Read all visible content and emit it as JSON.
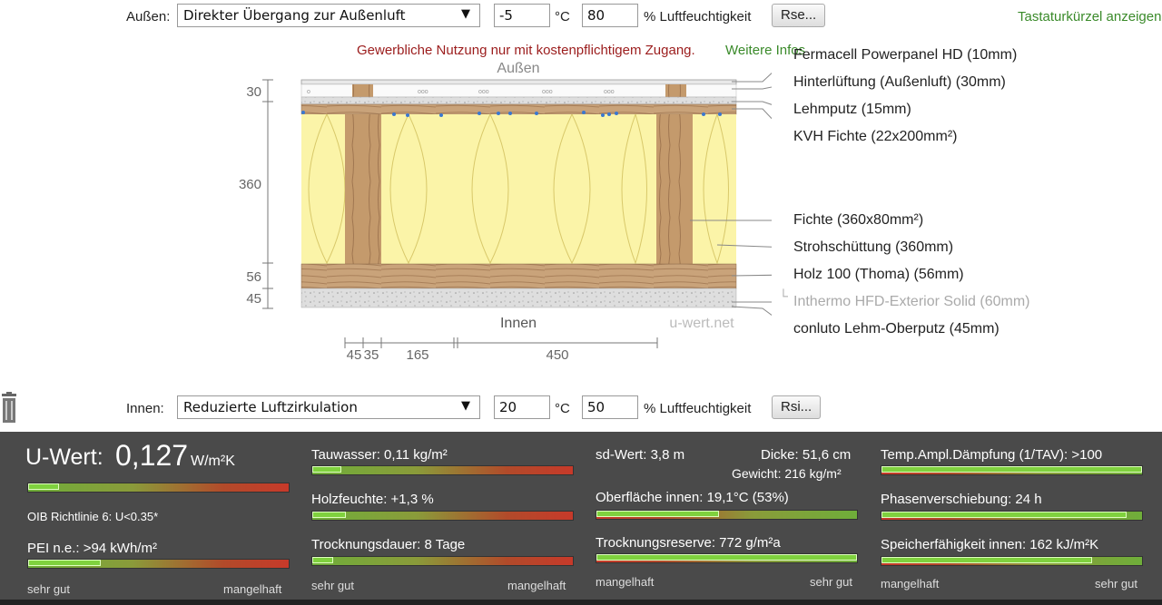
{
  "top": {
    "aussen_label": "Außen:",
    "aussen_select": "Direkter Übergang zur Außenluft",
    "aussen_temp": "-5",
    "temp_unit": "°C",
    "aussen_humidity": "80",
    "humidity_unit": "% Luftfeuchtigkeit",
    "rse_button": "Rse...",
    "shortcuts": "Tastaturkürzel anzeigen"
  },
  "notice": {
    "text": "Gewerbliche Nutzung nur mit kostenpflichtigem Zugang.",
    "link": "Weitere Infos"
  },
  "diagram": {
    "outside_label": "Außen",
    "inside_label": "Innen",
    "watermark": "u-wert.net",
    "dim_left": [
      "30",
      "360",
      "56",
      "45"
    ],
    "dim_bottom": [
      "45",
      "35",
      "165",
      "450"
    ],
    "layers": [
      {
        "label": "Fermacell Powerpanel HD (10mm)",
        "muted": false
      },
      {
        "label": "Hinterlüftung (Außenluft) (30mm)",
        "muted": false
      },
      {
        "label": "Lehmputz (15mm)",
        "muted": false
      },
      {
        "label": "KVH Fichte (22x200mm²)",
        "muted": false
      },
      {
        "label": "Fichte (360x80mm²)",
        "muted": false
      },
      {
        "label": "Strohschüttung (360mm)",
        "muted": false
      },
      {
        "label": "Holz 100 (Thoma) (56mm)",
        "muted": false
      },
      {
        "label": "Inthermo HFD-Exterior Solid (60mm)",
        "muted": true
      },
      {
        "label": "conluto Lehm-Oberputz (45mm)",
        "muted": false
      }
    ]
  },
  "bottom": {
    "innen_label": "Innen:",
    "innen_select": "Reduzierte Luftzirkulation",
    "innen_temp": "20",
    "temp_unit": "°C",
    "innen_humidity": "50",
    "humidity_unit": "% Luftfeuchtigkeit",
    "rsi_button": "Rsi..."
  },
  "results": {
    "uwert_label": "U-Wert:",
    "uwert_value": "0,127",
    "uwert_unit": "W/m²K",
    "uwert_level": 0.12,
    "oib": "OIB Richtlinie 6: U<0.35*",
    "pei": "PEI n.e.: >94 kWh/m²",
    "pei_level": 0.28,
    "tauwasser": "Tauwasser: 0,11 kg/m²",
    "tauwasser_level": 0.11,
    "holzfeuchte": "Holzfeuchte: +1,3 %",
    "holzfeuchte_level": 0.13,
    "trocknung": "Trocknungsdauer: 8 Tage",
    "trocknung_level": 0.08,
    "sd": "sd-Wert: 3,8 m",
    "dicke": "Dicke: 51,6 cm",
    "gewicht": "Gewicht: 216 kg/m²",
    "oberflaeche": "Oberfläche innen: 19,1°C (53%)",
    "oberflaeche_level": 0.47,
    "reserve": "Trocknungsreserve: 772 g/m²a",
    "reserve_level": 1.0,
    "tav": "Temp.Ampl.Dämpfung (1/TAV): >100",
    "tav_level": 1.0,
    "phase": "Phasenverschiebung: 24 h",
    "phase_level": 0.94,
    "speicher": "Speicherfähigkeit innen: 162 kJ/m²K",
    "speicher_level": 0.81,
    "sehr_gut": "sehr gut",
    "mangelhaft": "mangelhaft"
  }
}
